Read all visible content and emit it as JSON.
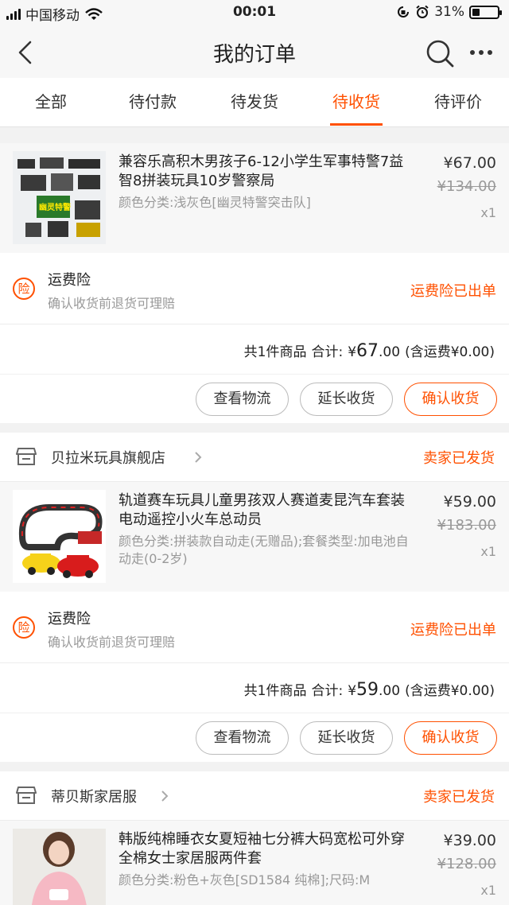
{
  "status_bar": {
    "carrier": "中国移动",
    "time": "00:01",
    "battery_percent": "31%",
    "battery_level": 0.31
  },
  "nav": {
    "title": "我的订单"
  },
  "tabs": [
    {
      "label": "全部"
    },
    {
      "label": "待付款"
    },
    {
      "label": "待发货"
    },
    {
      "label": "待收货",
      "active": true
    },
    {
      "label": "待评价"
    }
  ],
  "orders": [
    {
      "item": {
        "name": "兼容乐高积木男孩子6-12小学生军事特警7益智8拼装玩具10岁警察局",
        "sku": "颜色分类:浅灰色[幽灵特警突击队]",
        "price": "¥67.00",
        "original_price": "¥134.00",
        "qty": "x1",
        "thumb_label": "幽灵特警"
      },
      "insurance": {
        "badge": "险",
        "title": "运费险",
        "subtitle": "确认收货前退货可理赔",
        "status": "运费险已出单"
      },
      "total": {
        "count_text": "共1件商品",
        "sum_label": "合计:",
        "currency": "¥",
        "amount": "67",
        "cents": ".00",
        "shipping": "(含运费¥0.00)"
      },
      "buttons": {
        "logistics": "查看物流",
        "extend": "延长收货",
        "confirm": "确认收货"
      }
    },
    {
      "shop": {
        "name": "贝拉米玩具旗舰店",
        "status": "卖家已发货"
      },
      "item": {
        "name": "轨道赛车玩具儿童男孩双人赛道麦昆汽车套装电动遥控小火车总动员",
        "sku": "颜色分类:拼装款自动走(无赠品);套餐类型:加电池自动走(0-2岁)",
        "price": "¥59.00",
        "original_price": "¥183.00",
        "qty": "x1"
      },
      "insurance": {
        "badge": "险",
        "title": "运费险",
        "subtitle": "确认收货前退货可理赔",
        "status": "运费险已出单"
      },
      "total": {
        "count_text": "共1件商品",
        "sum_label": "合计:",
        "currency": "¥",
        "amount": "59",
        "cents": ".00",
        "shipping": "(含运费¥0.00)"
      },
      "buttons": {
        "logistics": "查看物流",
        "extend": "延长收货",
        "confirm": "确认收货"
      }
    },
    {
      "shop": {
        "name": "蒂贝斯家居服",
        "status": "卖家已发货"
      },
      "item": {
        "name": "韩版纯棉睡衣女夏短袖七分裤大码宽松可外穿全棉女士家居服两件套",
        "sku": "颜色分类:粉色+灰色[SD1584 纯棉];尺码:M",
        "price": "¥39.00",
        "original_price": "¥128.00",
        "qty": "x1"
      }
    }
  ]
}
